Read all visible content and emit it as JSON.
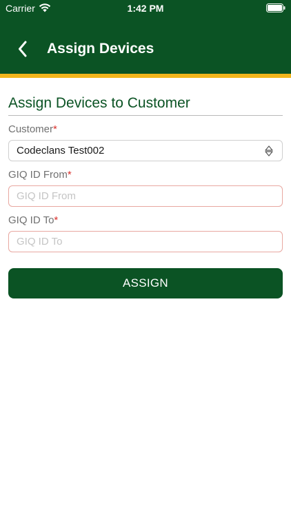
{
  "status_bar": {
    "carrier": "Carrier",
    "time": "1:42 PM",
    "wifi_icon": "wifi-icon",
    "battery_icon": "battery-icon"
  },
  "header": {
    "back_icon": "chevron-left-icon",
    "title": "Assign Devices",
    "background_color": "#0b5324",
    "stripe_color": "#f2b51c"
  },
  "form": {
    "section_title": "Assign Devices to Customer",
    "required_marker": "*",
    "customer": {
      "label": "Customer",
      "value": "Codeclans Test002",
      "arrow_icon": "up-down-arrows-icon"
    },
    "giq_from": {
      "label": "GIQ ID From",
      "value": "",
      "placeholder": "GIQ ID From"
    },
    "giq_to": {
      "label": "GIQ ID To",
      "value": "",
      "placeholder": "GIQ ID To"
    },
    "submit_label": "ASSIGN"
  },
  "colors": {
    "brand_green": "#0b5324",
    "accent_yellow": "#f2b51c",
    "required_red": "#d9302c",
    "input_error_border": "#e8a7a0"
  }
}
